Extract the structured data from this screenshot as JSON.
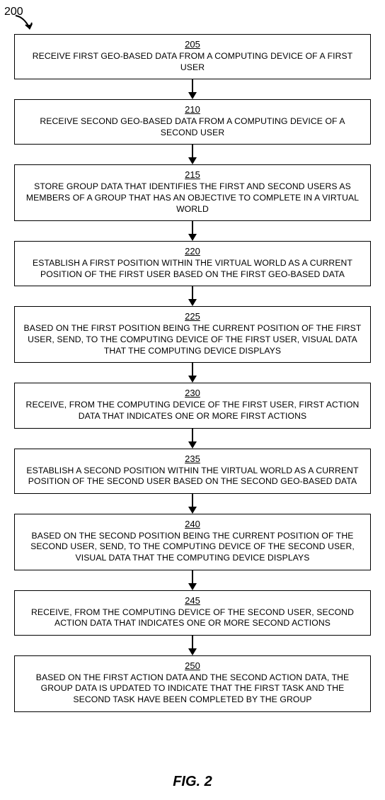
{
  "figure": {
    "ref_label": "200",
    "caption": "FIG. 2"
  },
  "steps": [
    {
      "num": "205",
      "text": "RECEIVE FIRST GEO-BASED DATA FROM A COMPUTING DEVICE OF A FIRST USER"
    },
    {
      "num": "210",
      "text": "RECEIVE SECOND GEO-BASED DATA FROM A COMPUTING DEVICE OF A SECOND USER"
    },
    {
      "num": "215",
      "text": "STORE GROUP DATA THAT IDENTIFIES THE FIRST AND SECOND USERS AS MEMBERS OF A GROUP THAT HAS AN OBJECTIVE TO COMPLETE IN A VIRTUAL WORLD"
    },
    {
      "num": "220",
      "text": "ESTABLISH A FIRST POSITION WITHIN THE VIRTUAL WORLD AS A CURRENT POSITION OF THE FIRST USER BASED ON THE FIRST GEO-BASED DATA"
    },
    {
      "num": "225",
      "text": "BASED ON THE FIRST POSITION BEING THE CURRENT POSITION OF THE FIRST USER, SEND, TO THE COMPUTING DEVICE OF THE FIRST USER, VISUAL DATA THAT THE COMPUTING DEVICE DISPLAYS"
    },
    {
      "num": "230",
      "text": "RECEIVE, FROM THE COMPUTING DEVICE OF THE FIRST USER, FIRST ACTION DATA THAT INDICATES ONE OR MORE FIRST ACTIONS"
    },
    {
      "num": "235",
      "text": "ESTABLISH A SECOND POSITION WITHIN THE VIRTUAL WORLD AS A CURRENT POSITION OF THE SECOND USER BASED ON THE SECOND GEO-BASED DATA"
    },
    {
      "num": "240",
      "text": "BASED ON THE SECOND POSITION BEING THE CURRENT POSITION OF THE SECOND USER, SEND, TO THE COMPUTING DEVICE OF THE SECOND USER, VISUAL DATA THAT THE COMPUTING DEVICE DISPLAYS"
    },
    {
      "num": "245",
      "text": "RECEIVE, FROM THE COMPUTING DEVICE OF THE SECOND USER, SECOND ACTION DATA THAT INDICATES ONE OR MORE SECOND ACTIONS"
    },
    {
      "num": "250",
      "text": "BASED ON THE FIRST ACTION DATA AND THE SECOND ACTION DATA, THE GROUP DATA IS UPDATED TO INDICATE THAT THE FIRST TASK AND THE SECOND TASK HAVE BEEN COMPLETED BY THE GROUP"
    }
  ]
}
